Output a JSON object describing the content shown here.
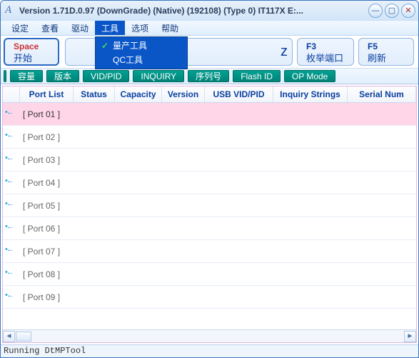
{
  "titlebar": {
    "title": "Version 1.71D.0.97 (DownGrade) (Native) (192108) (Type 0) IT117X E:..."
  },
  "menu": {
    "items": [
      "设定",
      "查看",
      "驱动",
      "工具",
      "选项",
      "帮助"
    ],
    "open_index": 3,
    "dropdown": [
      {
        "checked": true,
        "label": "量产工具"
      },
      {
        "checked": false,
        "label": "QC工具"
      }
    ]
  },
  "actions": {
    "space": {
      "top": "Space",
      "bottom": "开始"
    },
    "spacer_z": "z",
    "f3": {
      "top": "F3",
      "bottom": "枚举端口"
    },
    "f5": {
      "top": "F5",
      "bottom": "刷新"
    }
  },
  "teal_tabs": [
    "容量",
    "版本",
    "VID/PID",
    "INQUIRY",
    "序列号",
    "Flash ID",
    "OP Mode"
  ],
  "table": {
    "headers": [
      "",
      "Port List",
      "Status",
      "Capacity",
      "Version",
      "USB VID/PID",
      "Inquiry Strings",
      "Serial Num"
    ],
    "rows": [
      {
        "port": "[ Port 01 ]",
        "selected": true
      },
      {
        "port": "[ Port 02 ]",
        "selected": false
      },
      {
        "port": "[ Port 03 ]",
        "selected": false
      },
      {
        "port": "[ Port 04 ]",
        "selected": false
      },
      {
        "port": "[ Port 05 ]",
        "selected": false
      },
      {
        "port": "[ Port 06 ]",
        "selected": false
      },
      {
        "port": "[ Port 07 ]",
        "selected": false
      },
      {
        "port": "[ Port 08 ]",
        "selected": false
      },
      {
        "port": "[ Port 09 ]",
        "selected": false
      }
    ]
  },
  "status": "Running DtMPTool"
}
